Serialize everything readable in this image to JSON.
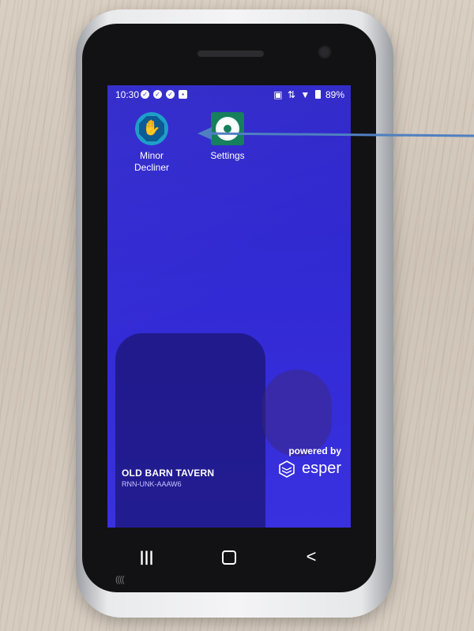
{
  "status_bar": {
    "time": "10:30",
    "battery_percent": "89%",
    "notification_icons": [
      "check-circle-icon",
      "check-circle-icon",
      "check-circle-icon",
      "briefcase-icon"
    ],
    "right_icons": [
      "nfc-icon",
      "data-arrows-icon",
      "wifi-icon",
      "battery-icon"
    ]
  },
  "apps": [
    {
      "label": "Minor Decliner",
      "icon": "hand-stop-icon",
      "color": "#1e9fc9"
    },
    {
      "label": "Settings",
      "icon": "gear-icon",
      "color": "#167f5d"
    }
  ],
  "venue": {
    "name": "OLD BARN TAVERN",
    "device_id": "RNN-UNK-AAAW6"
  },
  "branding": {
    "powered_by": "powered by",
    "name": "esper"
  },
  "nav_bar": {
    "recents": "|||",
    "home": "",
    "back": "<"
  },
  "colors": {
    "screen_background": "#3129d2",
    "annotation_arrow": "#4f7fc0"
  }
}
